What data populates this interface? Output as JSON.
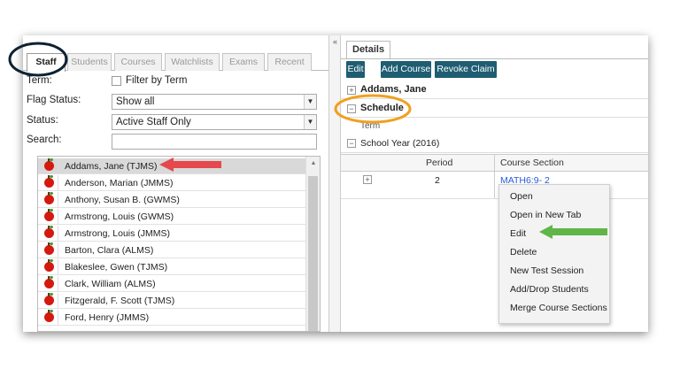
{
  "left_panel": {
    "tabs": [
      "Staff",
      "Students",
      "Courses",
      "Watchlists",
      "Exams",
      "Recent"
    ],
    "active_tab": "Staff",
    "collapse_glyph": "«",
    "term_label": "Term:",
    "filter_by_term_label": "Filter by Term",
    "flag_status_label": "Flag Status:",
    "flag_status_value": "Show all",
    "status_label": "Status:",
    "status_value": "Active Staff Only",
    "search_label": "Search:",
    "search_value": "",
    "staff_list": [
      "Addams, Jane (TJMS)",
      "Anderson, Marian (JMMS)",
      "Anthony, Susan B. (GWMS)",
      "Armstrong, Louis (GWMS)",
      "Armstrong, Louis (JMMS)",
      "Barton, Clara (ALMS)",
      "Blakeslee, Gwen (TJMS)",
      "Clark, William (ALMS)",
      "Fitzgerald, F. Scott (TJMS)",
      "Ford, Henry (JMMS)"
    ],
    "selected_index": 0,
    "list_icon": "apple-icon"
  },
  "right_panel": {
    "details_tab": "Details",
    "toolbar": {
      "edit_label": "Edit",
      "add_course_label": "Add Course",
      "revoke_claim_label": "Revoke Claim"
    },
    "person_section": "Addams, Jane",
    "schedule_section": "Schedule",
    "term_header": "Term",
    "school_year": "School Year (2016)",
    "grid_headers": {
      "period": "Period",
      "course_section": "Course Section"
    },
    "row": {
      "period": "2",
      "course_section": "MATH6:9- 2"
    },
    "expand_glyph": "+",
    "collapse_glyph": "−"
  },
  "context_menu": {
    "items": [
      "Open",
      "Open in New Tab",
      "Edit",
      "Delete",
      "New Test Session",
      "Add/Drop Students",
      "Merge Course Sections"
    ]
  },
  "colors": {
    "toolbar_button": "#1e5d72",
    "link": "#2a5bd7",
    "staff_circle": "#0d2233",
    "schedule_circle": "#f0a020",
    "red_arrow": "#e5484d",
    "green_arrow": "#5fb548"
  }
}
